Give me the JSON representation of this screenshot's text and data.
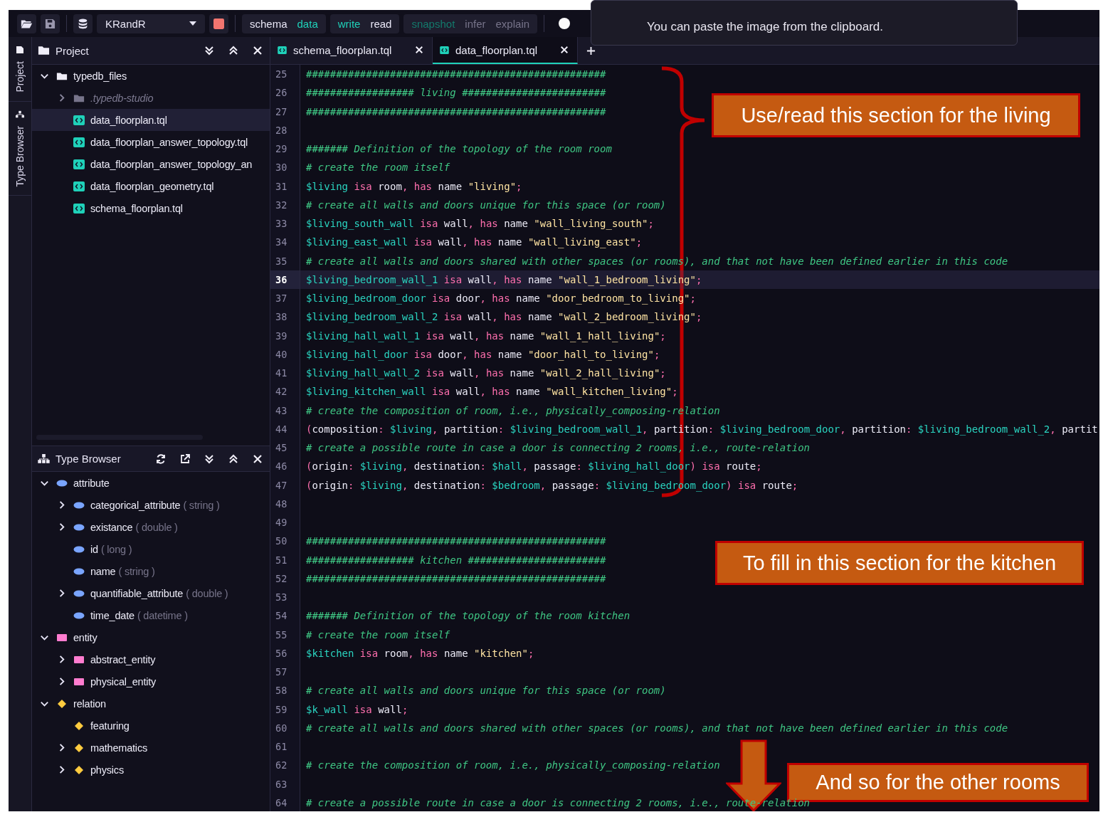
{
  "toolbar": {
    "database": "KRandR",
    "session_types": [
      {
        "label": "schema",
        "selected": false
      },
      {
        "label": "data",
        "selected": true
      }
    ],
    "transaction_types": [
      {
        "label": "write",
        "selected": true
      },
      {
        "label": "read",
        "selected": false
      }
    ],
    "options": [
      {
        "label": "snapshot",
        "on": true
      },
      {
        "label": "infer",
        "on": false
      },
      {
        "label": "explain",
        "on": false
      }
    ]
  },
  "tooltip": {
    "text": "You can paste the image from the clipboard."
  },
  "side_rail": [
    {
      "label": "Project",
      "kind": "project"
    },
    {
      "label": "Type Browser",
      "kind": "types"
    }
  ],
  "project": {
    "title": "Project",
    "tree": [
      {
        "label": "typedb_files",
        "kind": "folder",
        "expanded": true,
        "selected": false,
        "children": [
          {
            "label": ".typedb-studio",
            "kind": "dotfolder",
            "expanded": false,
            "selected": false
          },
          {
            "label": "data_floorplan.tql",
            "kind": "file",
            "selected": true
          },
          {
            "label": "data_floorplan_answer_topology.tql",
            "kind": "file",
            "selected": false
          },
          {
            "label": "data_floorplan_answer_topology_an",
            "kind": "file",
            "selected": false
          },
          {
            "label": "data_floorplan_geometry.tql",
            "kind": "file",
            "selected": false
          },
          {
            "label": "schema_floorplan.tql",
            "kind": "file",
            "selected": false
          }
        ]
      }
    ]
  },
  "type_browser": {
    "title": "Type Browser",
    "tree": [
      {
        "label": "attribute",
        "kind": "attribute",
        "expanded": true,
        "children": [
          {
            "label": "categorical_attribute",
            "value_type": "( string )",
            "kind": "attribute",
            "expanded": false
          },
          {
            "label": "existance",
            "value_type": "( double )",
            "kind": "attribute",
            "expanded": false
          },
          {
            "label": "id",
            "value_type": "( long )",
            "kind": "attribute"
          },
          {
            "label": "name",
            "value_type": "( string )",
            "kind": "attribute"
          },
          {
            "label": "quantifiable_attribute",
            "value_type": "( double )",
            "kind": "attribute",
            "expanded": false
          },
          {
            "label": "time_date",
            "value_type": "( datetime )",
            "kind": "attribute"
          }
        ]
      },
      {
        "label": "entity",
        "kind": "entity",
        "expanded": true,
        "children": [
          {
            "label": "abstract_entity",
            "kind": "entity",
            "expanded": false
          },
          {
            "label": "physical_entity",
            "kind": "entity",
            "expanded": false
          }
        ]
      },
      {
        "label": "relation",
        "kind": "relation",
        "expanded": true,
        "children": [
          {
            "label": "featuring",
            "kind": "relation"
          },
          {
            "label": "mathematics",
            "kind": "relation",
            "expanded": false
          },
          {
            "label": "physics",
            "kind": "relation",
            "expanded": false
          }
        ]
      }
    ]
  },
  "editor": {
    "tabs": [
      {
        "label": "schema_floorplan.tql",
        "selected": false
      },
      {
        "label": "data_floorplan.tql",
        "selected": true
      }
    ],
    "lines": [
      {
        "number": "25",
        "highlighted": false,
        "tokens": [
          {
            "kind": "comment",
            "text": "##################################################"
          }
        ]
      },
      {
        "number": "26",
        "highlighted": false,
        "tokens": [
          {
            "kind": "comment",
            "text": "################## living ########################"
          }
        ]
      },
      {
        "number": "27",
        "highlighted": false,
        "tokens": [
          {
            "kind": "comment",
            "text": "##################################################"
          }
        ]
      },
      {
        "number": "28",
        "highlighted": false
      },
      {
        "number": "29",
        "highlighted": false,
        "tokens": [
          {
            "kind": "comment",
            "text": "####### Definition of the topology of the room room"
          }
        ]
      },
      {
        "number": "30",
        "highlighted": false,
        "tokens": [
          {
            "kind": "comment",
            "text": "# create the room itself"
          }
        ]
      },
      {
        "number": "31",
        "highlighted": false,
        "tokens": [
          {
            "kind": "variable",
            "text": "$living"
          },
          {
            "kind": "keyword",
            "text": " isa"
          },
          {
            "kind": "type",
            "text": " room"
          },
          {
            "kind": "punctuation",
            "text": ","
          },
          {
            "kind": "keyword",
            "text": " has"
          },
          {
            "kind": "type",
            "text": " name"
          },
          {
            "kind": "string",
            "text": " \"living\""
          },
          {
            "kind": "punctuation",
            "text": ";"
          }
        ]
      },
      {
        "number": "32",
        "highlighted": false,
        "tokens": [
          {
            "kind": "comment",
            "text": "# create all walls and doors unique for this space (or room)"
          }
        ]
      },
      {
        "number": "33",
        "highlighted": false,
        "tokens": [
          {
            "kind": "variable",
            "text": "$living_south_wall"
          },
          {
            "kind": "keyword",
            "text": " isa"
          },
          {
            "kind": "type",
            "text": " wall"
          },
          {
            "kind": "punctuation",
            "text": ","
          },
          {
            "kind": "keyword",
            "text": " has"
          },
          {
            "kind": "type",
            "text": " name"
          },
          {
            "kind": "string",
            "text": " \"wall_living_south\""
          },
          {
            "kind": "punctuation",
            "text": ";"
          }
        ]
      },
      {
        "number": "34",
        "highlighted": false,
        "tokens": [
          {
            "kind": "variable",
            "text": "$living_east_wall"
          },
          {
            "kind": "keyword",
            "text": " isa"
          },
          {
            "kind": "type",
            "text": " wall"
          },
          {
            "kind": "punctuation",
            "text": ","
          },
          {
            "kind": "keyword",
            "text": " has"
          },
          {
            "kind": "type",
            "text": " name"
          },
          {
            "kind": "string",
            "text": " \"wall_living_east\""
          },
          {
            "kind": "punctuation",
            "text": ";"
          }
        ]
      },
      {
        "number": "35",
        "highlighted": false,
        "tokens": [
          {
            "kind": "comment",
            "text": "# create all walls and doors shared with other spaces (or rooms), and that not have been defined earlier in this code"
          }
        ]
      },
      {
        "number": "36",
        "highlighted": true,
        "tokens": [
          {
            "kind": "variable",
            "text": "$living_bedroom_wall_1"
          },
          {
            "kind": "keyword",
            "text": " isa"
          },
          {
            "kind": "type",
            "text": " wall"
          },
          {
            "kind": "punctuation",
            "text": ","
          },
          {
            "kind": "keyword",
            "text": " has"
          },
          {
            "kind": "type",
            "text": " name"
          },
          {
            "kind": "string",
            "text": " \"wall_1_bedroom_living\""
          },
          {
            "kind": "punctuation",
            "text": ";"
          }
        ]
      },
      {
        "number": "37",
        "highlighted": false,
        "tokens": [
          {
            "kind": "variable",
            "text": "$living_bedroom_door"
          },
          {
            "kind": "keyword",
            "text": " isa"
          },
          {
            "kind": "type",
            "text": " door"
          },
          {
            "kind": "punctuation",
            "text": ","
          },
          {
            "kind": "keyword",
            "text": " has"
          },
          {
            "kind": "type",
            "text": " name"
          },
          {
            "kind": "string",
            "text": " \"door_bedroom_to_living\""
          },
          {
            "kind": "punctuation",
            "text": ";"
          }
        ]
      },
      {
        "number": "38",
        "highlighted": false,
        "tokens": [
          {
            "kind": "variable",
            "text": "$living_bedroom_wall_2"
          },
          {
            "kind": "keyword",
            "text": " isa"
          },
          {
            "kind": "type",
            "text": " wall"
          },
          {
            "kind": "punctuation",
            "text": ","
          },
          {
            "kind": "keyword",
            "text": " has"
          },
          {
            "kind": "type",
            "text": " name"
          },
          {
            "kind": "string",
            "text": " \"wall_2_bedroom_living\""
          },
          {
            "kind": "punctuation",
            "text": ";"
          }
        ]
      },
      {
        "number": "39",
        "highlighted": false,
        "tokens": [
          {
            "kind": "variable",
            "text": "$living_hall_wall_1"
          },
          {
            "kind": "keyword",
            "text": " isa"
          },
          {
            "kind": "type",
            "text": " wall"
          },
          {
            "kind": "punctuation",
            "text": ","
          },
          {
            "kind": "keyword",
            "text": " has"
          },
          {
            "kind": "type",
            "text": " name"
          },
          {
            "kind": "string",
            "text": " \"wall_1_hall_living\""
          },
          {
            "kind": "punctuation",
            "text": ";"
          }
        ]
      },
      {
        "number": "40",
        "highlighted": false,
        "tokens": [
          {
            "kind": "variable",
            "text": "$living_hall_door"
          },
          {
            "kind": "keyword",
            "text": " isa"
          },
          {
            "kind": "type",
            "text": " door"
          },
          {
            "kind": "punctuation",
            "text": ","
          },
          {
            "kind": "keyword",
            "text": " has"
          },
          {
            "kind": "type",
            "text": " name"
          },
          {
            "kind": "string",
            "text": " \"door_hall_to_living\""
          },
          {
            "kind": "punctuation",
            "text": ";"
          }
        ]
      },
      {
        "number": "41",
        "highlighted": false,
        "tokens": [
          {
            "kind": "variable",
            "text": "$living_hall_wall_2"
          },
          {
            "kind": "keyword",
            "text": " isa"
          },
          {
            "kind": "type",
            "text": " wall"
          },
          {
            "kind": "punctuation",
            "text": ","
          },
          {
            "kind": "keyword",
            "text": " has"
          },
          {
            "kind": "type",
            "text": " name"
          },
          {
            "kind": "string",
            "text": " \"wall_2_hall_living\""
          },
          {
            "kind": "punctuation",
            "text": ";"
          }
        ]
      },
      {
        "number": "42",
        "highlighted": false,
        "tokens": [
          {
            "kind": "variable",
            "text": "$living_kitchen_wall"
          },
          {
            "kind": "keyword",
            "text": " isa"
          },
          {
            "kind": "type",
            "text": " wall"
          },
          {
            "kind": "punctuation",
            "text": ","
          },
          {
            "kind": "keyword",
            "text": " has"
          },
          {
            "kind": "type",
            "text": " name"
          },
          {
            "kind": "string",
            "text": " \"wall_kitchen_living\""
          },
          {
            "kind": "punctuation",
            "text": ";"
          }
        ]
      },
      {
        "number": "43",
        "highlighted": false,
        "tokens": [
          {
            "kind": "comment",
            "text": "# create the composition of room, i.e., physically_composing-relation"
          }
        ]
      },
      {
        "number": "44",
        "highlighted": false,
        "tokens": [
          {
            "kind": "punctuation",
            "text": "("
          },
          {
            "kind": "role",
            "text": "composition"
          },
          {
            "kind": "punctuation",
            "text": ":"
          },
          {
            "kind": "variable",
            "text": " $living"
          },
          {
            "kind": "punctuation",
            "text": ","
          },
          {
            "kind": "role",
            "text": " partition"
          },
          {
            "kind": "punctuation",
            "text": ":"
          },
          {
            "kind": "variable",
            "text": " $living_bedroom_wall_1"
          },
          {
            "kind": "punctuation",
            "text": ","
          },
          {
            "kind": "role",
            "text": " partition"
          },
          {
            "kind": "punctuation",
            "text": ":"
          },
          {
            "kind": "variable",
            "text": " $living_bedroom_door"
          },
          {
            "kind": "punctuation",
            "text": ","
          },
          {
            "kind": "role",
            "text": " partition"
          },
          {
            "kind": "punctuation",
            "text": ":"
          },
          {
            "kind": "variable",
            "text": " $living_bedroom_wall_2"
          },
          {
            "kind": "punctuation",
            "text": ","
          },
          {
            "kind": "role",
            "text": " partit"
          }
        ]
      },
      {
        "number": "45",
        "highlighted": false,
        "tokens": [
          {
            "kind": "comment",
            "text": "# create a possible route in case a door is connecting 2 rooms, i.e., route-relation"
          }
        ]
      },
      {
        "number": "46",
        "highlighted": false,
        "tokens": [
          {
            "kind": "punctuation",
            "text": "("
          },
          {
            "kind": "role",
            "text": "origin"
          },
          {
            "kind": "punctuation",
            "text": ":"
          },
          {
            "kind": "variable",
            "text": " $living"
          },
          {
            "kind": "punctuation",
            "text": ","
          },
          {
            "kind": "role",
            "text": " destination"
          },
          {
            "kind": "punctuation",
            "text": ":"
          },
          {
            "kind": "variable",
            "text": " $hall"
          },
          {
            "kind": "punctuation",
            "text": ","
          },
          {
            "kind": "role",
            "text": " passage"
          },
          {
            "kind": "punctuation",
            "text": ":"
          },
          {
            "kind": "variable",
            "text": " $living_hall_door"
          },
          {
            "kind": "punctuation",
            "text": ")"
          },
          {
            "kind": "keyword",
            "text": " isa"
          },
          {
            "kind": "type",
            "text": " route"
          },
          {
            "kind": "punctuation",
            "text": ";"
          }
        ]
      },
      {
        "number": "47",
        "highlighted": false,
        "tokens": [
          {
            "kind": "punctuation",
            "text": "("
          },
          {
            "kind": "role",
            "text": "origin"
          },
          {
            "kind": "punctuation",
            "text": ":"
          },
          {
            "kind": "variable",
            "text": " $living"
          },
          {
            "kind": "punctuation",
            "text": ","
          },
          {
            "kind": "role",
            "text": " destination"
          },
          {
            "kind": "punctuation",
            "text": ":"
          },
          {
            "kind": "variable",
            "text": " $bedroom"
          },
          {
            "kind": "punctuation",
            "text": ","
          },
          {
            "kind": "role",
            "text": " passage"
          },
          {
            "kind": "punctuation",
            "text": ":"
          },
          {
            "kind": "variable",
            "text": " $living_bedroom_door"
          },
          {
            "kind": "punctuation",
            "text": ")"
          },
          {
            "kind": "keyword",
            "text": " isa"
          },
          {
            "kind": "type",
            "text": " route"
          },
          {
            "kind": "punctuation",
            "text": ";"
          }
        ]
      },
      {
        "number": "48",
        "highlighted": false
      },
      {
        "number": "49",
        "highlighted": false
      },
      {
        "number": "50",
        "highlighted": false,
        "tokens": [
          {
            "kind": "comment",
            "text": "##################################################"
          }
        ]
      },
      {
        "number": "51",
        "highlighted": false,
        "tokens": [
          {
            "kind": "comment",
            "text": "################## kitchen #######################"
          }
        ]
      },
      {
        "number": "52",
        "highlighted": false,
        "tokens": [
          {
            "kind": "comment",
            "text": "##################################################"
          }
        ]
      },
      {
        "number": "53",
        "highlighted": false
      },
      {
        "number": "54",
        "highlighted": false,
        "tokens": [
          {
            "kind": "comment",
            "text": "####### Definition of the topology of the room kitchen"
          }
        ]
      },
      {
        "number": "55",
        "highlighted": false,
        "tokens": [
          {
            "kind": "comment",
            "text": "# create the room itself"
          }
        ]
      },
      {
        "number": "56",
        "highlighted": false,
        "tokens": [
          {
            "kind": "variable",
            "text": "$kitchen"
          },
          {
            "kind": "keyword",
            "text": " isa"
          },
          {
            "kind": "type",
            "text": " room"
          },
          {
            "kind": "punctuation",
            "text": ","
          },
          {
            "kind": "keyword",
            "text": " has"
          },
          {
            "kind": "type",
            "text": " name"
          },
          {
            "kind": "string",
            "text": " \"kitchen\""
          },
          {
            "kind": "punctuation",
            "text": ";"
          }
        ]
      },
      {
        "number": "57",
        "highlighted": false
      },
      {
        "number": "58",
        "highlighted": false,
        "tokens": [
          {
            "kind": "comment",
            "text": "# create all walls and doors unique for this space (or room)"
          }
        ]
      },
      {
        "number": "59",
        "highlighted": false,
        "tokens": [
          {
            "kind": "variable",
            "text": "$k_wall"
          },
          {
            "kind": "keyword",
            "text": " isa"
          },
          {
            "kind": "type",
            "text": " wall"
          },
          {
            "kind": "punctuation",
            "text": ";"
          }
        ]
      },
      {
        "number": "60",
        "highlighted": false,
        "tokens": [
          {
            "kind": "comment",
            "text": "# create all walls and doors shared with other spaces (or rooms), and that not have been defined earlier in this code"
          }
        ]
      },
      {
        "number": "61",
        "highlighted": false
      },
      {
        "number": "62",
        "highlighted": false,
        "tokens": [
          {
            "kind": "comment",
            "text": "# create the composition of room, i.e., physically_composing-relation"
          }
        ]
      },
      {
        "number": "63",
        "highlighted": false
      },
      {
        "number": "64",
        "highlighted": false,
        "tokens": [
          {
            "kind": "comment",
            "text": "# create a possible route in case a door is connecting 2 rooms, i.e., route-relation"
          }
        ]
      }
    ]
  },
  "callouts": [
    {
      "text": "Use/read this section for the living"
    },
    {
      "text": "To fill in this section for the kitchen"
    },
    {
      "text": "And so for the other rooms"
    }
  ]
}
